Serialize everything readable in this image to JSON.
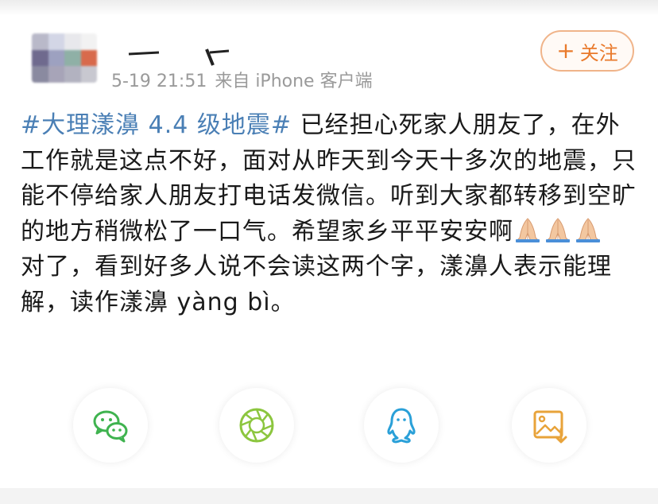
{
  "header": {
    "timestamp": "5-19 21:51",
    "source": "来自 iPhone 客户端",
    "follow_label": "关注"
  },
  "post": {
    "hashtag": "#大理漾濞 4.4 级地震#",
    "text_1": " 已经担心死家人朋友了，在外工作就是这点不好，面对从昨天到今天十多次的地震，只能不停给家人朋友打电话发微信。听到大家都转移到空旷的地方稍微松了一口气。希望家乡平平安安啊",
    "emoji": "praying-hands-emoji",
    "text_2": "对了，看到好多人说不会读这两个字，漾濞人表示能理解，读作漾濞 yàng bì。"
  },
  "share": {
    "items": [
      {
        "icon": "wechat-icon",
        "color": "#3fb34f"
      },
      {
        "icon": "moments-icon",
        "color": "#8cc63f"
      },
      {
        "icon": "qq-icon",
        "color": "#2aa0d8"
      },
      {
        "icon": "save-image-icon",
        "color": "#e8a33a"
      }
    ]
  },
  "colors": {
    "hashtag": "#4a7fb5",
    "follow_accent": "#e97a2c",
    "meta_text": "#9a9a9a"
  }
}
